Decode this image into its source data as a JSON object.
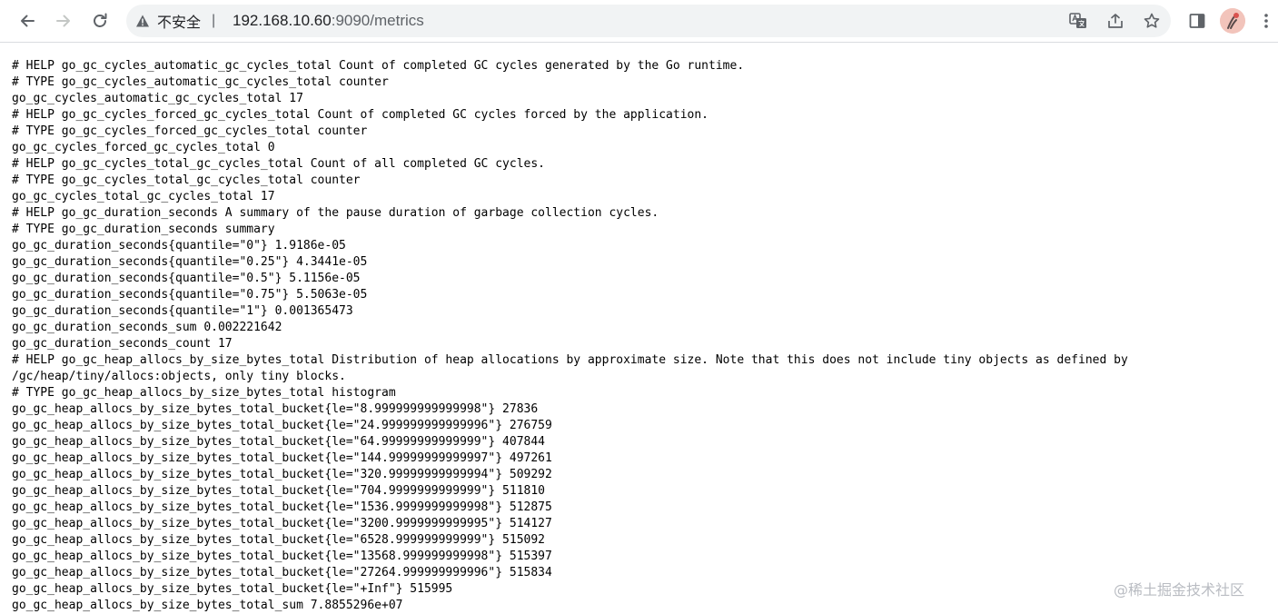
{
  "browser": {
    "security_label": "不安全",
    "security_separator": "|",
    "url_host": "192.168.10.60",
    "url_rest": ":9090/metrics"
  },
  "page": {
    "lines": [
      "# HELP go_gc_cycles_automatic_gc_cycles_total Count of completed GC cycles generated by the Go runtime.",
      "# TYPE go_gc_cycles_automatic_gc_cycles_total counter",
      "go_gc_cycles_automatic_gc_cycles_total 17",
      "# HELP go_gc_cycles_forced_gc_cycles_total Count of completed GC cycles forced by the application.",
      "# TYPE go_gc_cycles_forced_gc_cycles_total counter",
      "go_gc_cycles_forced_gc_cycles_total 0",
      "# HELP go_gc_cycles_total_gc_cycles_total Count of all completed GC cycles.",
      "# TYPE go_gc_cycles_total_gc_cycles_total counter",
      "go_gc_cycles_total_gc_cycles_total 17",
      "# HELP go_gc_duration_seconds A summary of the pause duration of garbage collection cycles.",
      "# TYPE go_gc_duration_seconds summary",
      "go_gc_duration_seconds{quantile=\"0\"} 1.9186e-05",
      "go_gc_duration_seconds{quantile=\"0.25\"} 4.3441e-05",
      "go_gc_duration_seconds{quantile=\"0.5\"} 5.1156e-05",
      "go_gc_duration_seconds{quantile=\"0.75\"} 5.5063e-05",
      "go_gc_duration_seconds{quantile=\"1\"} 0.001365473",
      "go_gc_duration_seconds_sum 0.002221642",
      "go_gc_duration_seconds_count 17",
      "# HELP go_gc_heap_allocs_by_size_bytes_total Distribution of heap allocations by approximate size. Note that this does not include tiny objects as defined by",
      "/gc/heap/tiny/allocs:objects, only tiny blocks.",
      "# TYPE go_gc_heap_allocs_by_size_bytes_total histogram",
      "go_gc_heap_allocs_by_size_bytes_total_bucket{le=\"8.999999999999998\"} 27836",
      "go_gc_heap_allocs_by_size_bytes_total_bucket{le=\"24.999999999999996\"} 276759",
      "go_gc_heap_allocs_by_size_bytes_total_bucket{le=\"64.99999999999999\"} 407844",
      "go_gc_heap_allocs_by_size_bytes_total_bucket{le=\"144.99999999999997\"} 497261",
      "go_gc_heap_allocs_by_size_bytes_total_bucket{le=\"320.99999999999994\"} 509292",
      "go_gc_heap_allocs_by_size_bytes_total_bucket{le=\"704.9999999999999\"} 511810",
      "go_gc_heap_allocs_by_size_bytes_total_bucket{le=\"1536.9999999999998\"} 512875",
      "go_gc_heap_allocs_by_size_bytes_total_bucket{le=\"3200.9999999999995\"} 514127",
      "go_gc_heap_allocs_by_size_bytes_total_bucket{le=\"6528.999999999999\"} 515092",
      "go_gc_heap_allocs_by_size_bytes_total_bucket{le=\"13568.999999999998\"} 515397",
      "go_gc_heap_allocs_by_size_bytes_total_bucket{le=\"27264.999999999996\"} 515834",
      "go_gc_heap_allocs_by_size_bytes_total_bucket{le=\"+Inf\"} 515995",
      "go_gc_heap_allocs_by_size_bytes_total_sum 7.8855296e+07"
    ],
    "watermark": "@稀土掘金技术社区"
  }
}
